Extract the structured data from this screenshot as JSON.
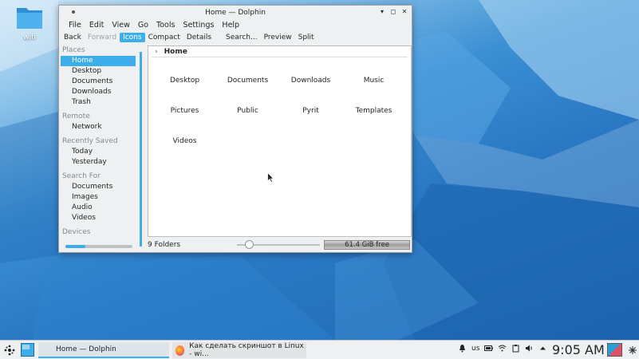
{
  "desktop": {
    "icon_label": "wifi"
  },
  "window": {
    "title": "Home — Dolphin",
    "controls": [
      "minimize-icon",
      "maximize-icon",
      "close-icon"
    ]
  },
  "menu": [
    "File",
    "Edit",
    "View",
    "Go",
    "Tools",
    "Settings",
    "Help"
  ],
  "toolbar": {
    "back": "Back",
    "forward": "Forward",
    "icons": "Icons",
    "compact": "Compact",
    "details": "Details",
    "search": "Search...",
    "preview": "Preview",
    "split": "Split"
  },
  "sidebar": {
    "places_header": "Places",
    "places": [
      "Home",
      "Desktop",
      "Documents",
      "Downloads",
      "Trash"
    ],
    "remote_header": "Remote",
    "remote": [
      "Network"
    ],
    "recent_header": "Recently Saved",
    "recent": [
      "Today",
      "Yesterday"
    ],
    "search_header": "Search For",
    "search": [
      "Documents",
      "Images",
      "Audio",
      "Videos"
    ],
    "devices_header": "Devices"
  },
  "breadcrumb": {
    "current": "Home"
  },
  "folders": [
    "Desktop",
    "Documents",
    "Downloads",
    "Music",
    "Pictures",
    "Public",
    "Pyrit",
    "Templates",
    "Videos"
  ],
  "status": {
    "count": "9 Folders",
    "free": "61.4 GiB free",
    "free_used_fraction": 0.55
  },
  "taskbar": {
    "task_active": "Home — Dolphin",
    "task_other": "Как сделать скриншот в Linux - wi...",
    "keyboard_layout": "us",
    "clock": "9:05 AM"
  },
  "colors": {
    "accent": "#3daee9",
    "panel": "#eff0f1",
    "desktop_blue": "#2a79c4"
  }
}
